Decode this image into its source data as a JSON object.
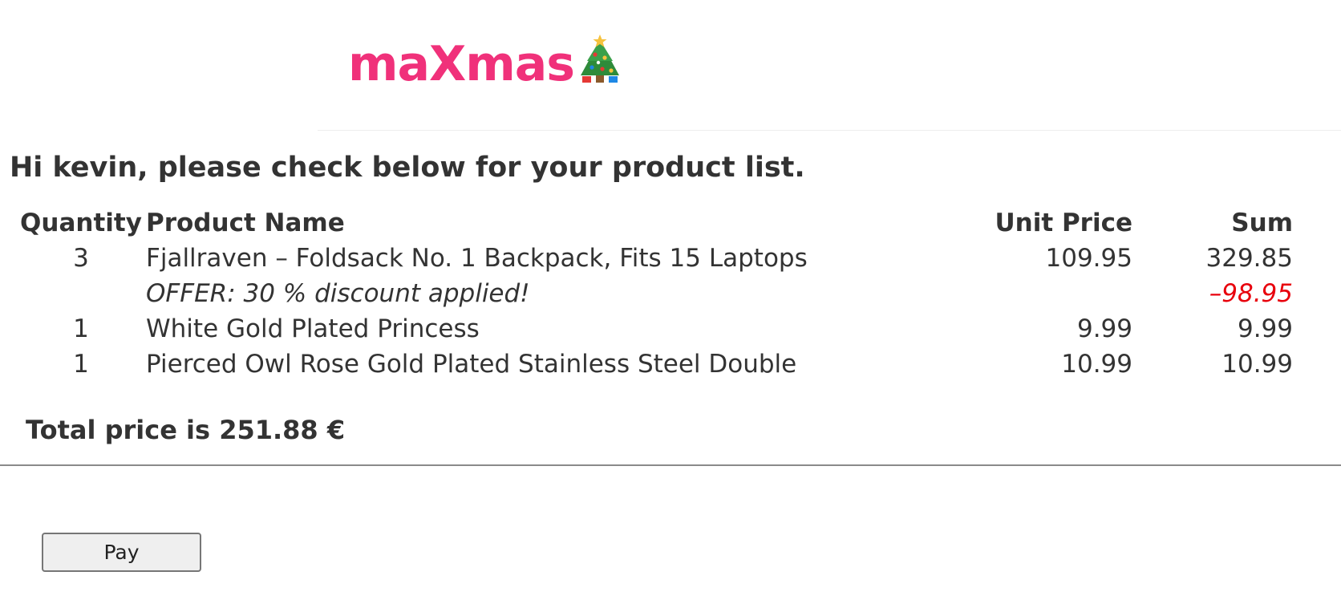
{
  "header": {
    "logo_text": "maXmas",
    "logo_emoji_icon": "christmas-tree-icon",
    "logo_color": "#f0317a"
  },
  "greeting": "Hi kevin, please check below for your product list.",
  "table": {
    "headers": {
      "quantity": "Quantity",
      "product_name": "Product Name",
      "unit_price": "Unit Price",
      "sum": "Sum"
    },
    "rows": [
      {
        "quantity": "3",
        "name": "Fjallraven – Foldsack No. 1 Backpack, Fits 15 Laptops",
        "unit_price": "109.95",
        "sum": "329.85"
      },
      {
        "quantity": "1",
        "name": "White Gold Plated Princess",
        "unit_price": "9.99",
        "sum": "9.99"
      },
      {
        "quantity": "1",
        "name": "Pierced Owl Rose Gold Plated Stainless Steel Double",
        "unit_price": "10.99",
        "sum": "10.99"
      }
    ],
    "offer": {
      "text": "OFFER: 30 % discount applied!",
      "value": "–98.95",
      "color": "#e8000c"
    }
  },
  "total": "Total price is 251.88 €",
  "pay_button_label": "Pay"
}
